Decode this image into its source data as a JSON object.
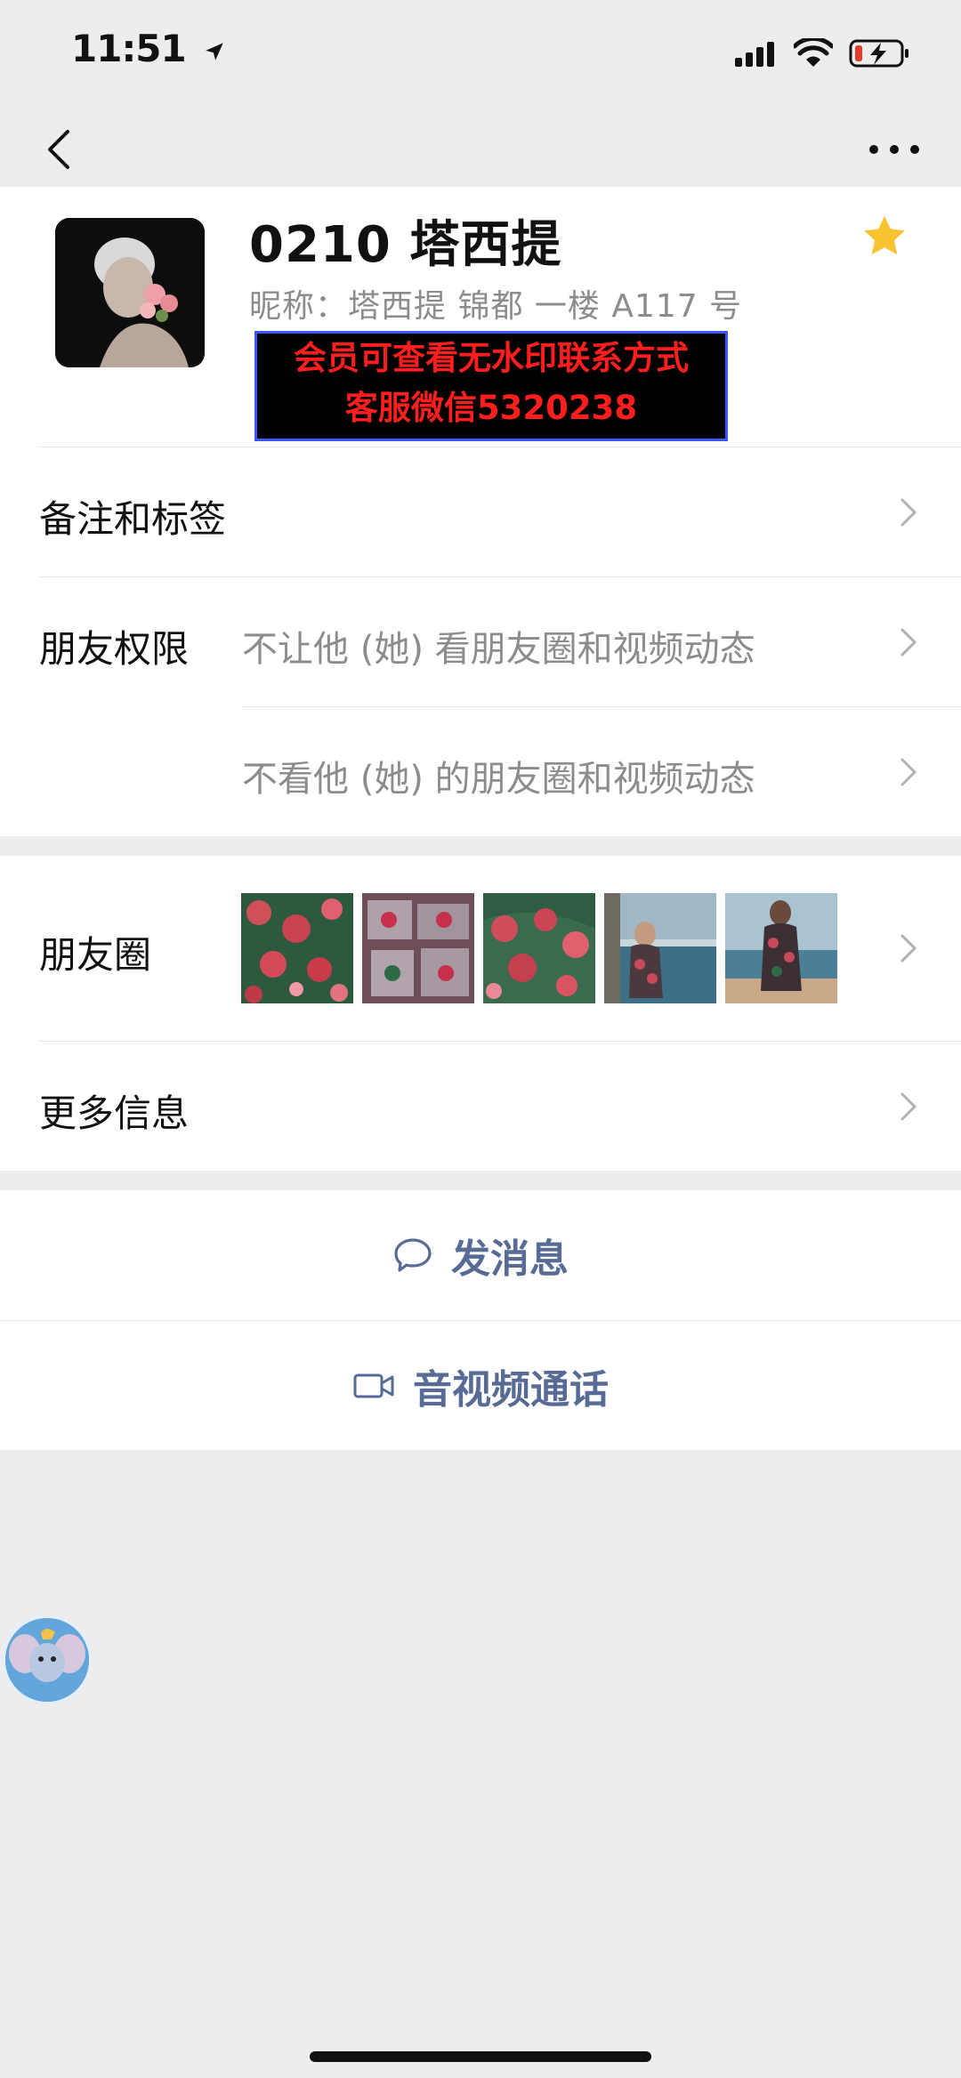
{
  "status_bar": {
    "time": "11:51"
  },
  "profile": {
    "title": "0210 塔西提",
    "nickname": "昵称：塔西提 锦都 一楼 A117 号",
    "watermark_line1": "会员可查看无水印联系方式",
    "watermark_line2": "客服微信5320238"
  },
  "rows": {
    "remarks_label": "备注和标签",
    "permissions_label": "朋友权限",
    "permission_1": "不让他 (她) 看朋友圈和视频动态",
    "permission_2": "不看他 (她) 的朋友圈和视频动态",
    "moments_label": "朋友圈",
    "more_info_label": "更多信息"
  },
  "actions": {
    "send_message": "发消息",
    "av_call": "音视频通话"
  },
  "colors": {
    "link": "#576b95",
    "star": "#f9c230",
    "background": "#ededed"
  }
}
